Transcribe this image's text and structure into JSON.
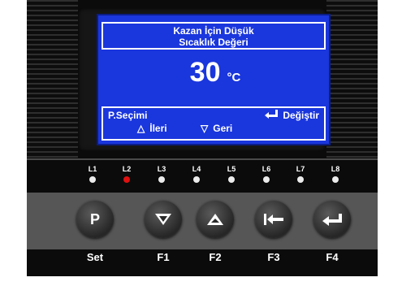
{
  "display": {
    "title_line1": "Kazan İçin Düşük",
    "title_line2": "Sıcaklık Değeri",
    "value": "30",
    "unit": "°C",
    "footer": {
      "select": "P.Seçimi",
      "change": "Değiştir",
      "forward": "İleri",
      "back": "Geri"
    }
  },
  "leds": [
    {
      "label": "L1",
      "on": false
    },
    {
      "label": "L2",
      "on": true
    },
    {
      "label": "L3",
      "on": false
    },
    {
      "label": "L4",
      "on": false
    },
    {
      "label": "L5",
      "on": false
    },
    {
      "label": "L6",
      "on": false
    },
    {
      "label": "L7",
      "on": false
    },
    {
      "label": "L8",
      "on": false
    }
  ],
  "buttons": [
    {
      "label": "Set",
      "glyph": "P",
      "icon": "p-letter"
    },
    {
      "label": "F1",
      "icon": "down-arrow-icon"
    },
    {
      "label": "F2",
      "icon": "up-arrow-icon"
    },
    {
      "label": "F3",
      "icon": "left-bar-arrow-icon"
    },
    {
      "label": "F4",
      "icon": "enter-arrow-icon"
    }
  ],
  "colors": {
    "lcd_background": "#1a36dd",
    "led_on": "#e01010",
    "led_off": "#ececec"
  }
}
